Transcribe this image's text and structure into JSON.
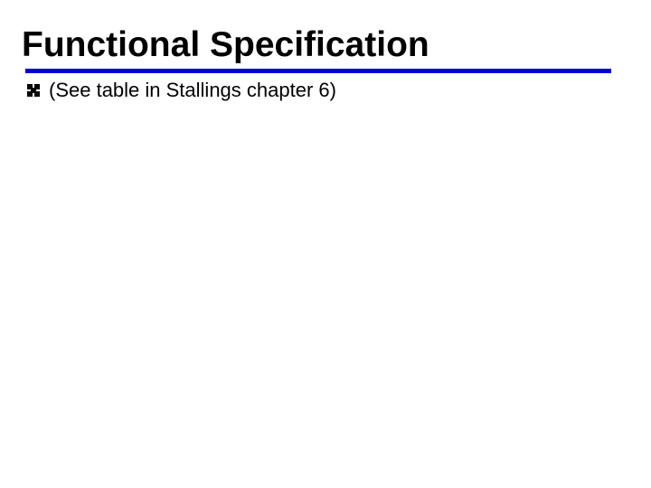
{
  "title": "Functional Specification",
  "bullets": [
    {
      "icon": "decorative-bullet",
      "text": "(See table in Stallings chapter 6)"
    }
  ],
  "colors": {
    "rule": "#0000d6",
    "text": "#000000",
    "background": "#ffffff"
  }
}
